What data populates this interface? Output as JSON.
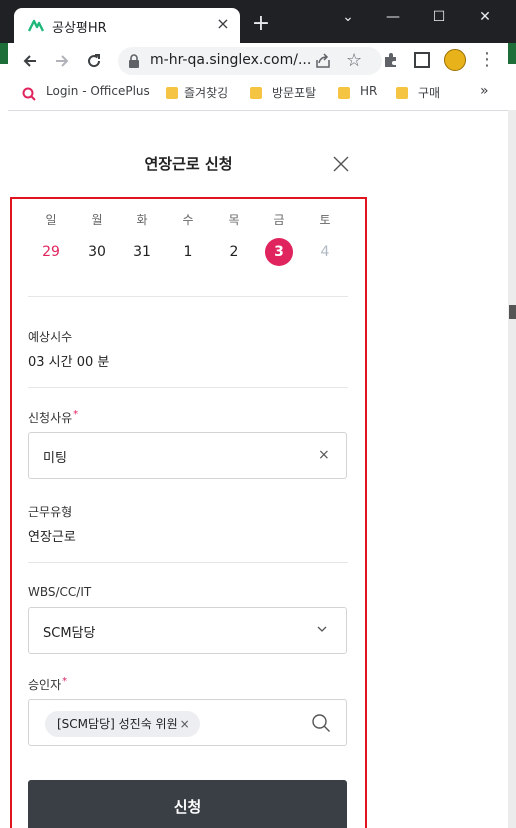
{
  "browser": {
    "tab_title": "공상평HR",
    "tab_close": "×",
    "new_tab": "+",
    "url": "m-hr-qa.singlex.com/...",
    "window_controls": {
      "minimize": "—",
      "maximize": "☐",
      "close": "✕",
      "dropdown": "⌄"
    },
    "bookmarks": [
      {
        "label": "Login - OfficePlus",
        "icon": "officeplus-icon"
      },
      {
        "label": "즐겨찾깅",
        "icon": "folder-icon"
      },
      {
        "label": "방문포탈",
        "icon": "folder-icon"
      },
      {
        "label": "HR",
        "icon": "folder-icon"
      },
      {
        "label": "구매",
        "icon": "folder-icon"
      }
    ],
    "bookmarks_more": "»"
  },
  "modal": {
    "title": "연장근로 신청",
    "calendar": {
      "weekdays": [
        "일",
        "월",
        "화",
        "수",
        "목",
        "금",
        "토"
      ],
      "days": [
        "29",
        "30",
        "31",
        "1",
        "2",
        "3",
        "4"
      ],
      "selected_day": "3",
      "colors": {
        "sunday": "#e0245e",
        "selected": "#e0245e",
        "saturday_muted": "#b0b8c4"
      }
    },
    "expected_hours": {
      "label": "예상시수",
      "value": "03 시간 00 분"
    },
    "reason": {
      "label": "신청사유",
      "required": "*",
      "value": "미팅",
      "clear": "×"
    },
    "work_type": {
      "label": "근무유형",
      "value": "연장근로"
    },
    "wbs": {
      "label": "WBS/CC/IT",
      "value": "SCM담당"
    },
    "approver": {
      "label": "승인자",
      "required": "*",
      "chip": "[SCM담당] 성진숙 위원",
      "chip_remove": "×"
    },
    "submit_label": "신청"
  },
  "colors": {
    "accent": "#e0245e",
    "highlight_border": "#e0141e",
    "submit_bg": "#3a3f45"
  }
}
